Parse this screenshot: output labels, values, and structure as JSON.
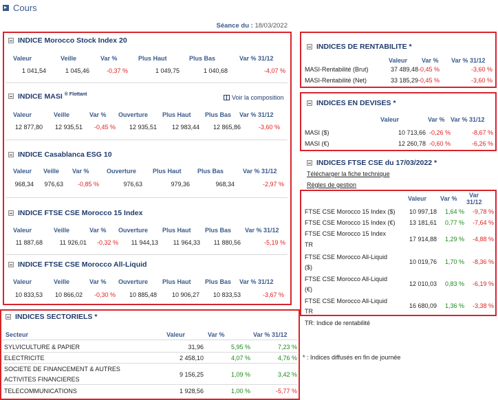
{
  "page": {
    "title": "Cours",
    "seance_label": "Séance du :",
    "seance_date": "18/03/2022"
  },
  "idx_morocco_stock": {
    "title": "INDICE Morocco Stock Index 20",
    "headers": [
      "Valeur",
      "Veille",
      "Var %",
      "Plus Haut",
      "Plus Bas",
      "Var % 31/12"
    ],
    "values": [
      "1 041,54",
      "1 045,46",
      "-0,37 %",
      "1 049,75",
      "1 040,68",
      "-4,07 %"
    ]
  },
  "idx_masi": {
    "title": "INDICE MASI",
    "sup": "® Flottant",
    "voir": "Voir la composition",
    "headers": [
      "Valeur",
      "Veille",
      "Var %",
      "Ouverture",
      "Plus Haut",
      "Plus Bas",
      "Var % 31/12"
    ],
    "values": [
      "12 877,80",
      "12 935,51",
      "-0,45 %",
      "12 935,51",
      "12 983,44",
      "12 865,86",
      "-3,60 %"
    ]
  },
  "idx_esg": {
    "title": "INDICE Casablanca ESG 10",
    "headers": [
      "Valeur",
      "Veille",
      "Var %",
      "Ouverture",
      "Plus Haut",
      "Plus Bas",
      "Var % 31/12"
    ],
    "values": [
      "968,34",
      "976,63",
      "-0,85 %",
      "976,63",
      "979,36",
      "968,34",
      "-2,97 %"
    ]
  },
  "idx_ftse15": {
    "title": "INDICE FTSE CSE Morocco 15 Index",
    "headers": [
      "Valeur",
      "Veille",
      "Var %",
      "Ouverture",
      "Plus Haut",
      "Plus Bas",
      "Var % 31/12"
    ],
    "values": [
      "11 887,68",
      "11 926,01",
      "-0,32 %",
      "11 944,13",
      "11 964,33",
      "11 880,56",
      "-5,19 %"
    ]
  },
  "idx_ftse_liquid": {
    "title": "INDICE FTSE CSE Morocco All-Liquid",
    "headers": [
      "Valeur",
      "Veille",
      "Var %",
      "Ouverture",
      "Plus Haut",
      "Plus Bas",
      "Var % 31/12"
    ],
    "values": [
      "10 833,53",
      "10 866,02",
      "-0,30 %",
      "10 885,48",
      "10 906,27",
      "10 833,53",
      "-3,67 %"
    ]
  },
  "sectoriels": {
    "title": "INDICES SECTORIELS *",
    "headers": [
      "Secteur",
      "Valeur",
      "Var %",
      "Var % 31/12"
    ],
    "rows": [
      {
        "name": "SYLVICULTURE & PAPIER",
        "name2": "",
        "valeur": "31,96",
        "var": "5,95 %",
        "var31": "7,23 %"
      },
      {
        "name": "ELECTRICITE",
        "name2": "",
        "valeur": "2 458,10",
        "var": "4,07 %",
        "var31": "4,76 %"
      },
      {
        "name": "SOCIETE DE FINANCEMENT & AUTRES",
        "name2": "ACTIVITES FINANCIERES",
        "valeur": "9 156,25",
        "var": "1,09 %",
        "var31": "3,42 %"
      },
      {
        "name": "TELECOMMUNICATIONS",
        "name2": "",
        "valeur": "1 928,56",
        "var": "1,00 %",
        "var31": "-5,77 %"
      }
    ]
  },
  "rentabilite": {
    "title": "INDICES DE RENTABILITE *",
    "headers": [
      "Valeur",
      "Var %",
      "Var % 31/12"
    ],
    "rows": [
      {
        "name": "MASI-Rentabilité (Brut)",
        "valeur": "37 489,48",
        "var": "-0,45 %",
        "var31": "-3,60 %"
      },
      {
        "name": "MASI-Rentabilité (Net)",
        "valeur": "33 185,29",
        "var": "-0,45 %",
        "var31": "-3,60 %"
      }
    ]
  },
  "devises": {
    "title": "INDICES EN DEVISES *",
    "headers": [
      "Valeur",
      "Var %",
      "Var % 31/12"
    ],
    "rows": [
      {
        "name": "MASI ($)",
        "valeur": "10 713,66",
        "var": "-0,26 %",
        "var31": "-8,67 %"
      },
      {
        "name": "MASI (€)",
        "valeur": "12 260,78",
        "var": "-0,60 %",
        "var31": "-6,26 %"
      }
    ]
  },
  "ftse_cse": {
    "title": "INDICES FTSE CSE du 17/03/2022 *",
    "link_fiche": "Télécharger la fiche technique",
    "link_regles": "Règles de gestion",
    "headers": [
      "Valeur",
      "Var %",
      "Var",
      "31/12"
    ],
    "rows": [
      {
        "name": "FTSE CSE Morocco 15 Index ($)",
        "name2": "",
        "valeur": "10 997,18",
        "var": "1,64 %",
        "var31": "-9,78 %"
      },
      {
        "name": "FTSE CSE Morocco 15 Index (€)",
        "name2": "",
        "valeur": "13 181,61",
        "var": "0,77 %",
        "var31": "-7,64 %"
      },
      {
        "name": "FTSE CSE Morocco 15 Index",
        "name2": "TR",
        "valeur": "17 914,88",
        "var": "1,29 %",
        "var31": "-4,88 %"
      },
      {
        "name": "FTSE CSE Morocco All-Liquid",
        "name2": "($)",
        "valeur": "10 019,76",
        "var": "1,70 %",
        "var31": "-8,36 %"
      },
      {
        "name": "FTSE CSE Morocco All-Liquid",
        "name2": "(€)",
        "valeur": "12 010,03",
        "var": "0,83 %",
        "var31": "-6,19 %"
      },
      {
        "name": "FTSE CSE Morocco All-Liquid",
        "name2": "TR",
        "valeur": "16 680,09",
        "var": "1,36 %",
        "var31": "-3,38 %"
      }
    ]
  },
  "notes": {
    "tr": "TR: Indice de rentabilité",
    "star": "* : Indices diffusés en fin de journée"
  },
  "colors": {
    "accent": "#1f3a6b",
    "header": "#3a5a8c",
    "negative": "#e02020",
    "positive": "#1a8a1a",
    "highlight": "#d8232a"
  }
}
